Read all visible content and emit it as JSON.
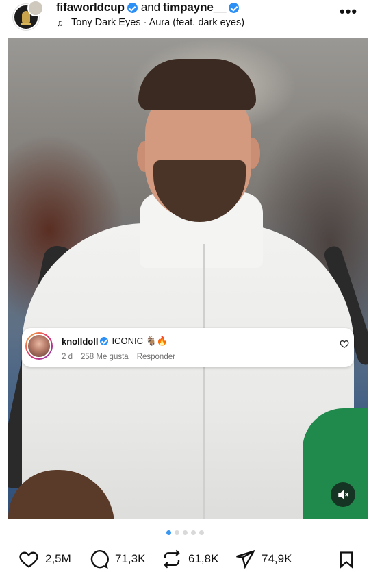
{
  "header": {
    "account1": "fifaworldcup",
    "connector": "and",
    "account2": "timpayne__",
    "audio": "Tony Dark Eyes · Aura (feat. dark eyes)",
    "more_icon": "more-horizontal-icon"
  },
  "comment": {
    "username": "knolldoll",
    "text": "ICONIC 🐐🔥",
    "age": "2 d",
    "likes": "258 Me gusta",
    "reply": "Responder"
  },
  "carousel": {
    "count": 5,
    "active": 0
  },
  "actions": {
    "likes": "2,5M",
    "comments": "71,3K",
    "reposts": "61,8K",
    "shares": "74,9K"
  },
  "colors": {
    "verified": "#2b8ff6",
    "active_dot": "#3897f0"
  }
}
